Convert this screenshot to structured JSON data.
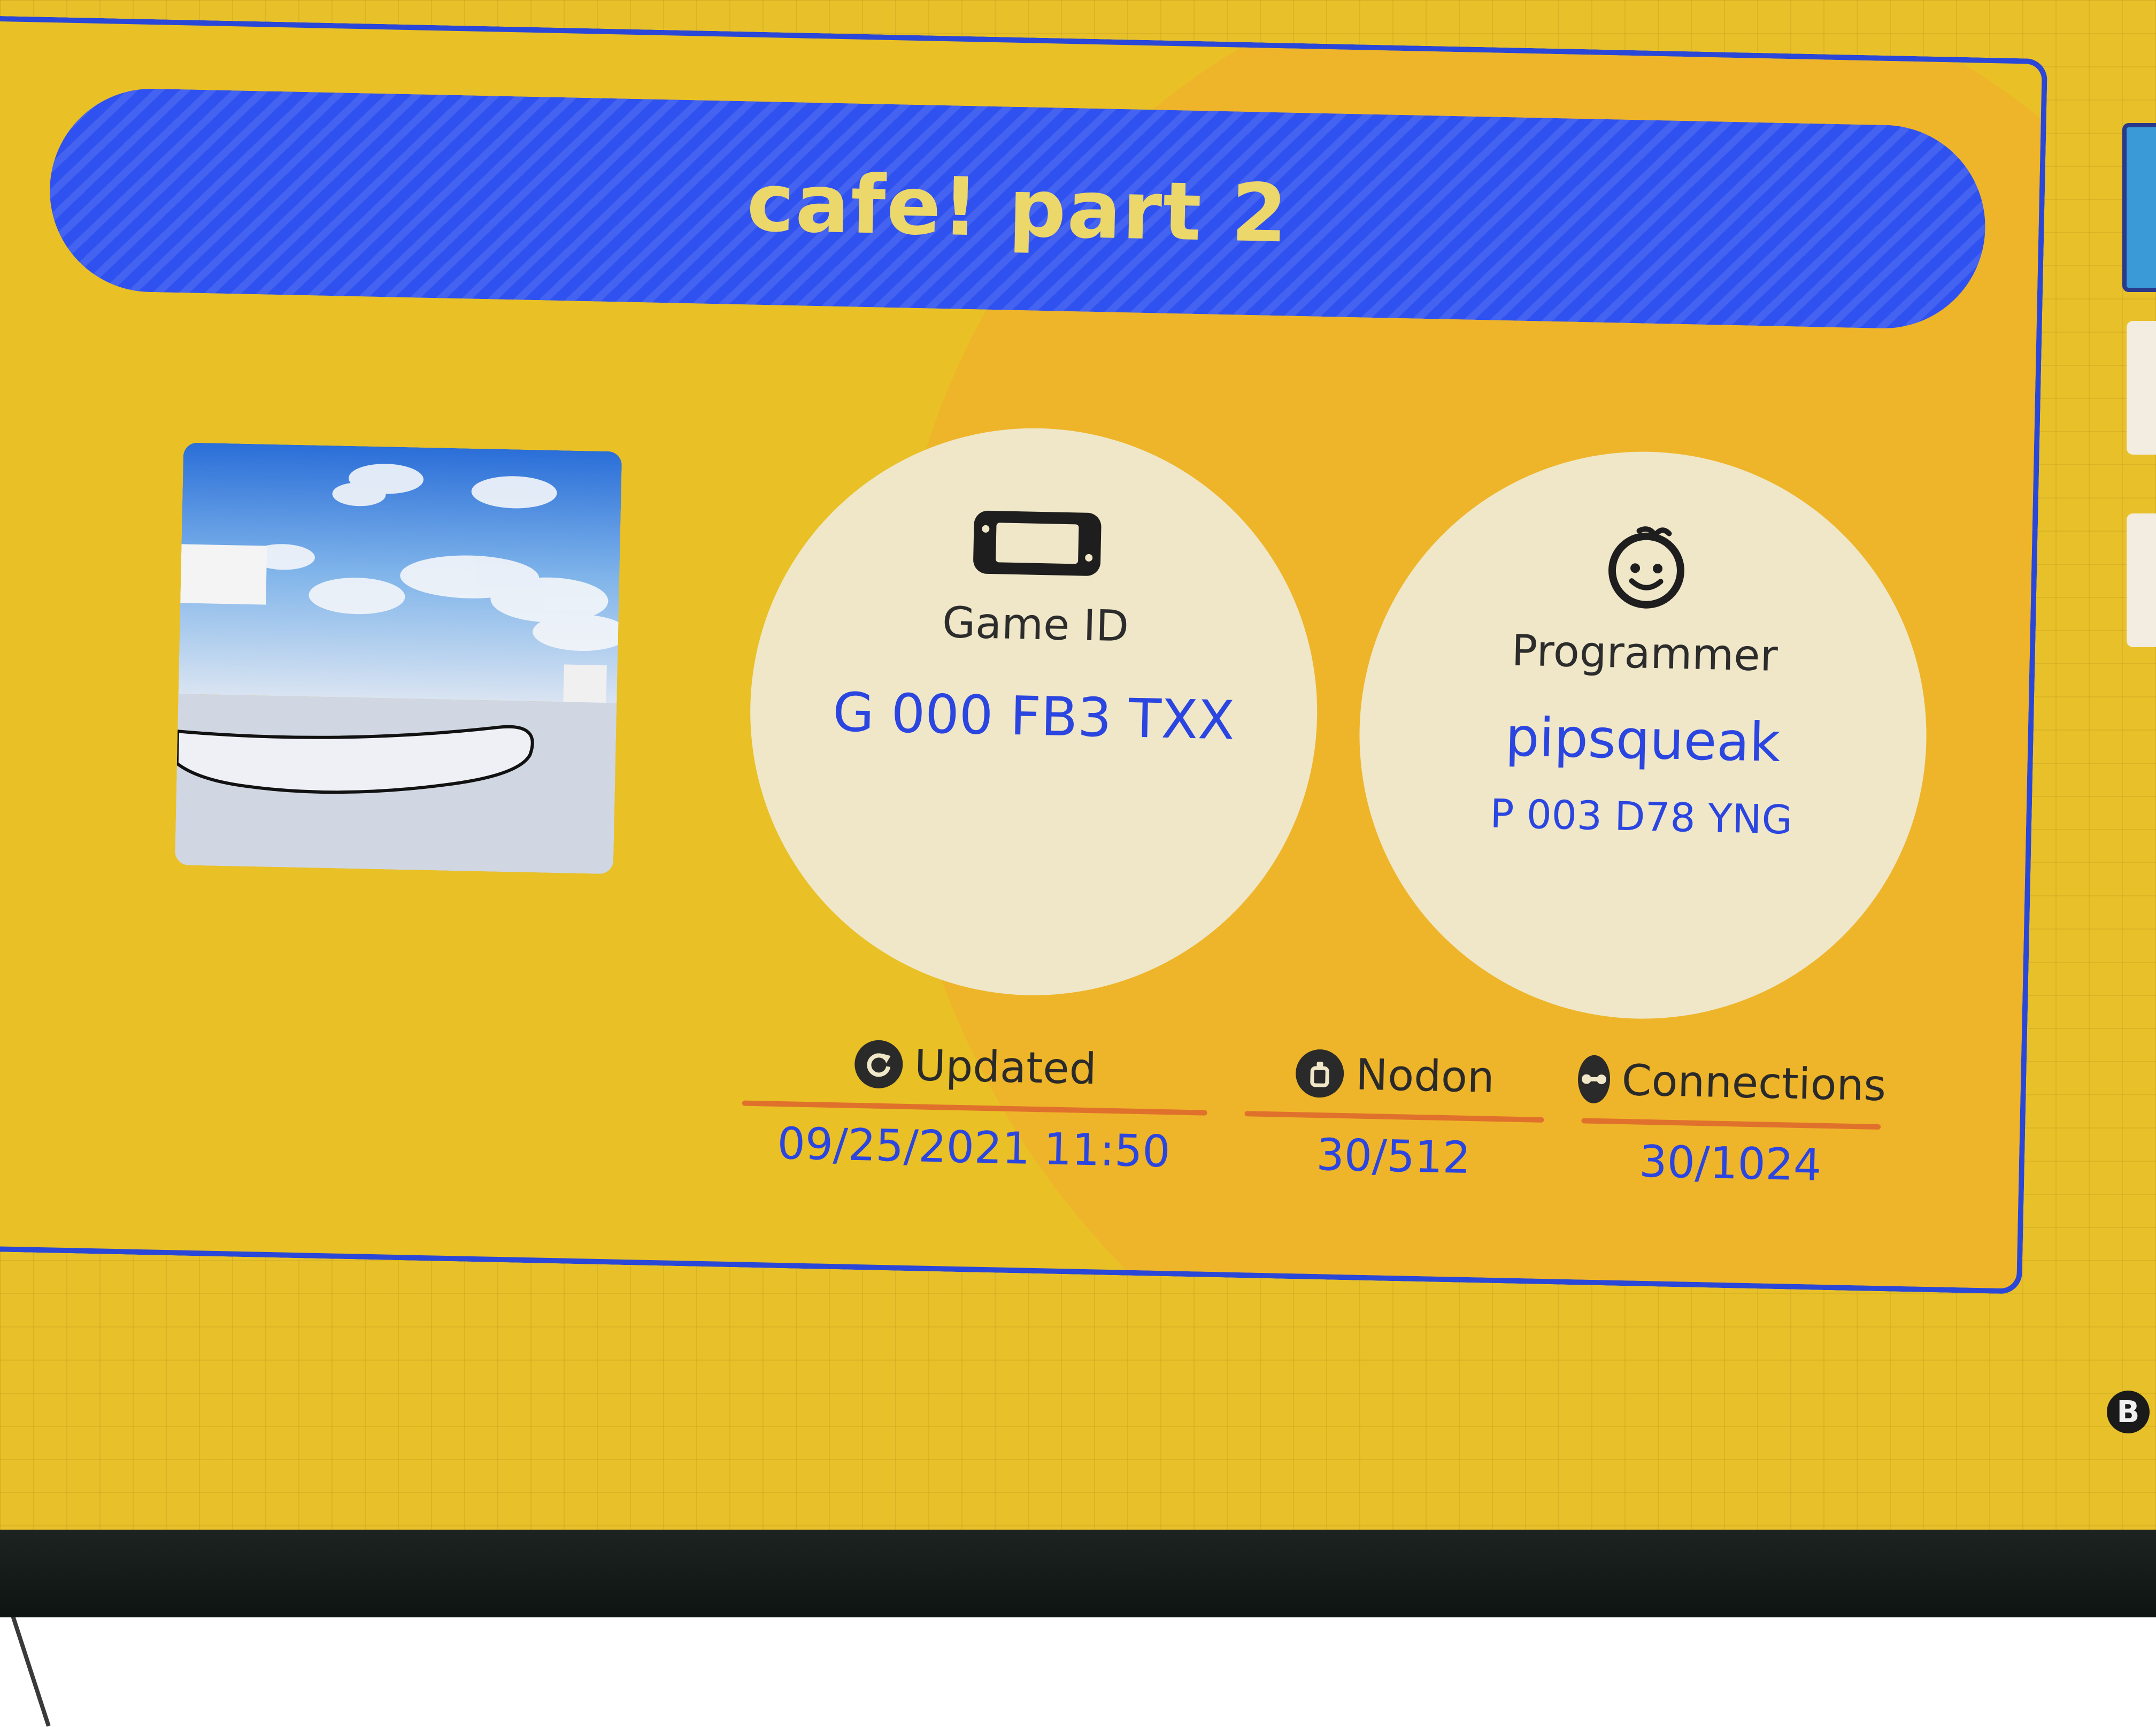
{
  "game": {
    "title": "cafe! part 2"
  },
  "game_id": {
    "label": "Game ID",
    "value": "G 000 FB3 TXX",
    "icon": "console-icon"
  },
  "programmer": {
    "label": "Programmer",
    "name": "pipsqueak",
    "id": "P 003 D78 YNG",
    "icon": "programmer-face-icon"
  },
  "stats": {
    "updated": {
      "label": "Updated",
      "value": "09/25/2021 11:50",
      "icon": "refresh-icon"
    },
    "nodon": {
      "label": "Nodon",
      "value": "30/512",
      "icon": "nodon-icon"
    },
    "connections": {
      "label": "Connections",
      "value": "30/1024",
      "icon": "connection-icon"
    }
  },
  "controls": {
    "back_button": "B"
  },
  "colors": {
    "background": "#e8c12a",
    "title_bar": "#2f51ef",
    "title_text": "#ecd76a",
    "value_text": "#2b45e0",
    "rule": "#e0712c",
    "circle": "#efe7c8"
  }
}
